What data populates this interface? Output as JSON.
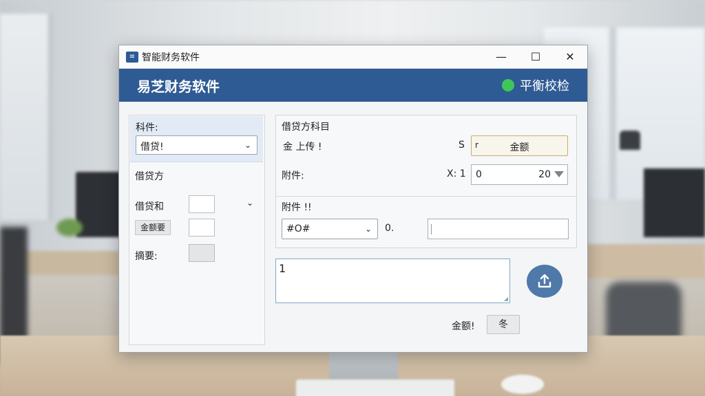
{
  "window": {
    "title": "智能财务软件",
    "controls": {
      "minimize": "—",
      "maximize": "☐",
      "close": "✕"
    }
  },
  "banner": {
    "title": "易芝财务软件",
    "status_label": "平衡校检",
    "status_color": "#3fc65a"
  },
  "left_panel": {
    "subject_label": "科件:",
    "subject_select_value": "借贷!",
    "debit_credit_label": "借贷方",
    "debit_and_label": "借贷和",
    "amount_tag": "金额要",
    "summary_label": "摘要:"
  },
  "right_panel": {
    "section_title": "借贷方科目",
    "upload_label": "金 上传 !",
    "s_label": "S",
    "amount_button_mark": "r",
    "amount_button_label": "金额",
    "attachment_label": "附件:",
    "x_label": "X: 1",
    "number_field_left": "0",
    "number_field_right": "20",
    "attachment2_label": "附件 !!",
    "select_value": "#O#",
    "zero_label": "0.",
    "text_field_value": ""
  },
  "notes": {
    "value": "1"
  },
  "footer": {
    "amount_label": "金额!",
    "button_label": "冬"
  },
  "icons": [
    "app-icon",
    "chevron-down-icon",
    "upload-icon",
    "status-dot-icon",
    "spinner-down-icon"
  ]
}
